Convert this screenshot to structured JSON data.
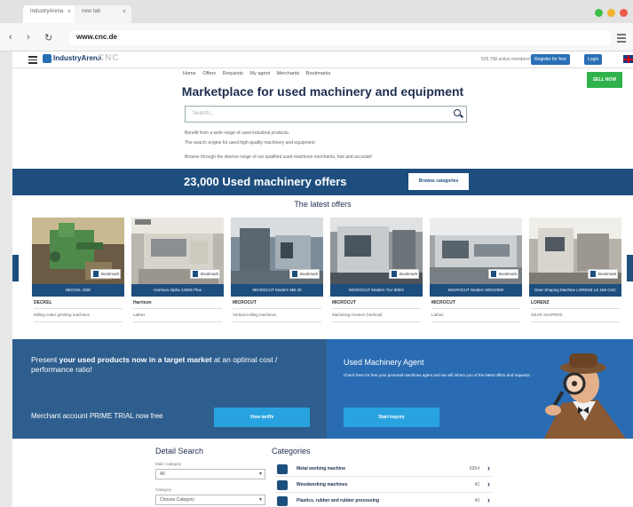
{
  "browser": {
    "tabs": [
      {
        "label": "IndustryArena"
      },
      {
        "label": "new tab"
      }
    ],
    "tab_close": "×",
    "url": "www.cnc.de",
    "back": "‹",
    "forward": "›",
    "reload": "↻"
  },
  "header": {
    "logo": "IndustryArena",
    "site_logo": "CNC",
    "members": "526.768 active members*",
    "register": "Register for free",
    "login": "Login"
  },
  "nav": {
    "items": [
      "Home",
      "Offers",
      "Requests",
      "My agent",
      "Merchants",
      "Bookmarks"
    ],
    "sell_now": "SELL NOW"
  },
  "hero": {
    "title": "Marketplace for used machinery and equipment",
    "search_placeholder": "Search...",
    "info1": "Benefit from a wide range of used industrial products.",
    "info2": "The search engine for used high-quality machinery and equipment",
    "info3": "Browse through the diverse range of our qualified used machines merchants, fast and accurate!"
  },
  "banner": {
    "title": "23,000 Used machinery offers",
    "button": "Browse categories"
  },
  "latest_title": "The latest offers",
  "bookmark_label": "Bookmark",
  "offers": [
    {
      "caption": "DECKEL SOE",
      "maker": "DECKEL",
      "category": "Milling cutter grinding machines"
    },
    {
      "caption": "Harrison Alpha 1330S Plus",
      "maker": "Harrison",
      "category": "Lathes"
    },
    {
      "caption": "MICROCUT Modern MB 20",
      "maker": "MICROCUT",
      "category": "Vertical milling machines"
    },
    {
      "caption": "MICROCUT Modern TLV 800/1",
      "maker": "MICROCUT",
      "category": "Machining Centers (Vertical)"
    },
    {
      "caption": "MICROCUT Modern MGX2500",
      "maker": "MICROCUT",
      "category": "Lathes"
    },
    {
      "caption": "Gear Shaping Machine LORENZ LS 156 CNC",
      "maker": "LORENZ",
      "category": "GEAR SHAPERS"
    }
  ],
  "promo_merchant": {
    "pre": "Present ",
    "bold": "your used products now in a target market",
    "post": " at an optimal cost / performance ratio!",
    "trial": "Merchant account PRIME TRIAL now free",
    "button": "View tariffs"
  },
  "promo_agent": {
    "title": "Used Machinery Agent",
    "description": "Check here for free your personal machines agent and we will inform you of the latest offers and requests",
    "button": "Start inquiry"
  },
  "detail_search": {
    "title": "Detail Search",
    "main_category_label": "Main Category",
    "main_category_value": "All",
    "category_label": "Category",
    "category_value": "Choose Category"
  },
  "categories": {
    "title": "Categories",
    "items": [
      {
        "name": "Metal working machine",
        "count": "6354",
        "chevron": "›"
      },
      {
        "name": "Woodworking machines",
        "count": "42",
        "chevron": "›"
      },
      {
        "name": "Plastics, rubber and rubber processing",
        "count": "43",
        "chevron": "›"
      }
    ]
  },
  "colors": {
    "navy": "#1d4e7e",
    "sell": "#2fb24c",
    "promo_button": "#29a3e0"
  }
}
